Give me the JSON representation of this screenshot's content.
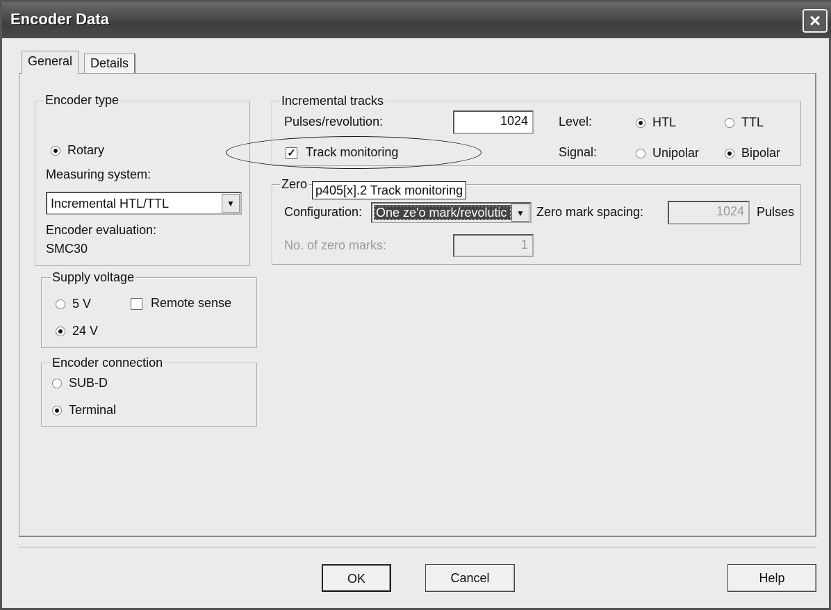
{
  "window": {
    "title": "Encoder Data",
    "close_icon": "close-icon"
  },
  "tabs": [
    {
      "label": "General",
      "active": true
    },
    {
      "label": "Details",
      "active": false
    }
  ],
  "encoder_type": {
    "legend": "Encoder type",
    "rotary": "Rotary",
    "measuring_system_label": "Measuring system:",
    "measuring_system_value": "Incremental HTL/TTL",
    "evaluation_label": "Encoder evaluation:",
    "evaluation_value": "SMC30"
  },
  "supply_voltage": {
    "legend": "Supply voltage",
    "v5": "5 V",
    "v24": "24 V",
    "remote_sense": "Remote sense",
    "selected": "24 V",
    "remote_sense_checked": false
  },
  "encoder_connection": {
    "legend": "Encoder connection",
    "subd": "SUB-D",
    "terminal": "Terminal",
    "selected": "Terminal"
  },
  "incremental_tracks": {
    "legend": "Incremental tracks",
    "pulses_label": "Pulses/revolution:",
    "pulses_value": "1024",
    "level_label": "Level:",
    "htl": "HTL",
    "ttl": "TTL",
    "level_selected": "HTL",
    "track_monitoring": "Track monitoring",
    "track_monitoring_checked": true,
    "signal_label": "Signal:",
    "unipolar": "Unipolar",
    "bipolar": "Bipolar",
    "signal_selected": "Bipolar"
  },
  "zero_mark": {
    "legend": "Zero",
    "tooltip": "p405[x].2 Track monitoring",
    "config_label": "Configuration:",
    "config_value": "One ze'o mark/revolutic",
    "spacing_label": "Zero mark spacing:",
    "spacing_value": "1024",
    "spacing_unit": "Pulses",
    "count_label": "No. of zero marks:",
    "count_value": "1"
  },
  "buttons": {
    "ok": "OK",
    "cancel": "Cancel",
    "help": "Help"
  }
}
